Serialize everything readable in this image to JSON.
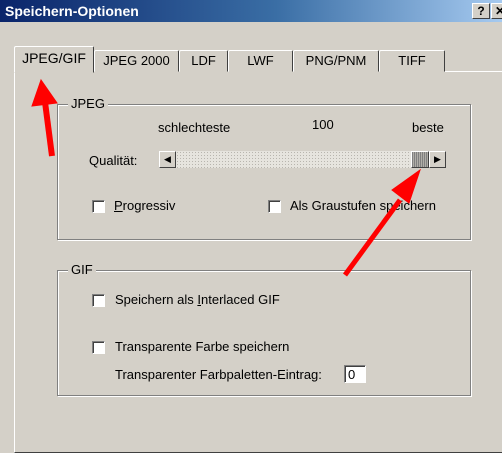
{
  "window": {
    "title": "Speichern-Optionen",
    "help_label": "?",
    "close_label": "✕"
  },
  "tabs": [
    {
      "label": "JPEG/GIF",
      "active": true
    },
    {
      "label": "JPEG 2000",
      "active": false
    },
    {
      "label": "LDF",
      "active": false
    },
    {
      "label": "LWF",
      "active": false
    },
    {
      "label": "PNG/PNM",
      "active": false
    },
    {
      "label": "TIFF",
      "active": false
    }
  ],
  "jpeg": {
    "legend": "JPEG",
    "worst_label": "schlechteste",
    "quality_value": "100",
    "best_label": "beste",
    "quality_label": "Qualität:",
    "progressive_pre": "",
    "progressive_key": "P",
    "progressive_post": "rogressiv",
    "grayscale_label": "Als Graustufen speichern",
    "slider_level": 1.0
  },
  "gif": {
    "legend": "GIF",
    "interlaced_pre": "Speichern als ",
    "interlaced_key": "I",
    "interlaced_post": "nterlaced GIF",
    "transparent_label": "Transparente Farbe speichern",
    "palette_label": "Transparenter Farbpaletten-Eintrag:",
    "palette_value": "0"
  },
  "colors": {
    "title_start": "#0a246a",
    "title_end": "#a6caf0",
    "annotation_arrow": "#ff0000",
    "face": "#d4d0c8"
  }
}
